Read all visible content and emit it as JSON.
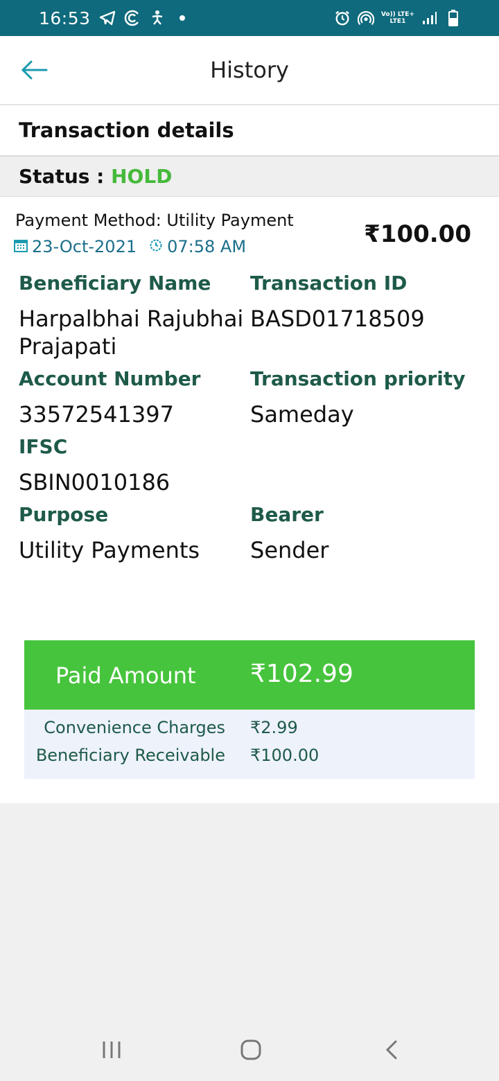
{
  "status_bar": {
    "time": "16:53",
    "network_top": "Vo)) LTE+",
    "network_bottom": "LTE1"
  },
  "app_bar": {
    "title": "History"
  },
  "section": {
    "title": "Transaction details",
    "status_label": "Status : ",
    "status_value": "HOLD",
    "status_color": "#45b93b"
  },
  "transaction": {
    "payment_method": "Payment Method: Utility Payment",
    "date": "23-Oct-2021",
    "time": "07:58 AM",
    "amount": "₹100.00",
    "fields": {
      "beneficiary_name_label": "Beneficiary Name",
      "beneficiary_name_value_line1": "Harpalbhai Rajubhai",
      "beneficiary_name_value_line2": "Prajapati",
      "transaction_id_label": "Transaction ID",
      "transaction_id_value": "BASD01718509",
      "account_number_label": "Account Number",
      "account_number_value": "33572541397",
      "transaction_priority_label": "Transaction priority",
      "transaction_priority_value": "Sameday",
      "ifsc_label": "IFSC",
      "ifsc_value": "SBIN0010186",
      "purpose_label": "Purpose",
      "purpose_value": "Utility Payments",
      "bearer_label": "Bearer",
      "bearer_value": "Sender"
    }
  },
  "summary": {
    "paid_amount_label": "Paid Amount",
    "paid_amount_value": "₹102.99",
    "convenience_label": "Convenience Charges",
    "convenience_value": "₹2.99",
    "receivable_label": "Beneficiary Receivable",
    "receivable_value": "₹100.00",
    "accent_color": "#47c43d"
  },
  "icons": {
    "back": "arrow-left-icon",
    "calendar": "calendar-icon",
    "clock": "clock-icon",
    "nav_recents": "recents-icon",
    "nav_home": "home-icon",
    "nav_back": "nav-back-icon"
  }
}
